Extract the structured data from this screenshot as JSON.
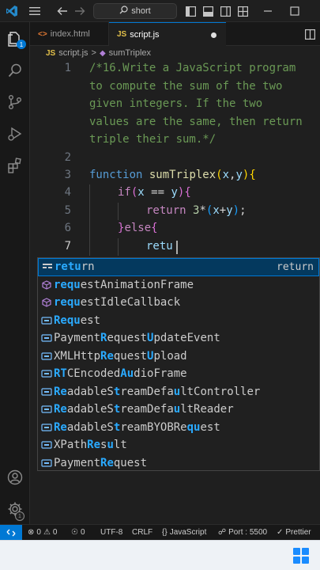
{
  "titlebar": {
    "search_text": "short",
    "icons": [
      "vscode-logo-icon",
      "menu-icon",
      "arrow-left-icon",
      "arrow-right-icon",
      "search-icon",
      "toggle-sidebar-icon",
      "toggle-panel-icon",
      "toggle-secondary-sidebar-icon",
      "customize-layout-icon",
      "minimize-icon",
      "maximize-icon"
    ]
  },
  "activity_bar": {
    "explorer_badge": "1",
    "items": [
      "explorer-icon",
      "search-icon",
      "source-control-icon",
      "run-debug-icon",
      "extensions-icon",
      "account-icon",
      "settings-gear-icon"
    ]
  },
  "tabs": [
    {
      "icon_text": "JS",
      "label": "index.html",
      "active": false
    },
    {
      "icon_text": "JS",
      "label": "script.js",
      "active": true,
      "modified": true
    }
  ],
  "breadcrumb": {
    "file": "script.js",
    "separator": ">",
    "symbol": "sumTriplex",
    "file_icon_text": "JS"
  },
  "editor": {
    "lines": [
      {
        "number": "1",
        "text": "/*16.Write a JavaScript program"
      },
      {
        "number": "",
        "text": "to compute the sum of the two"
      },
      {
        "number": "",
        "text": "given integers. If the two"
      },
      {
        "number": "",
        "text": "values are the same, then return"
      },
      {
        "number": "",
        "text": "triple their sum.*/"
      },
      {
        "number": "2",
        "text": ""
      },
      {
        "number": "3",
        "text": "function sumTriplex(x,y){"
      },
      {
        "number": "4",
        "text": "if(x == y){"
      },
      {
        "number": "5",
        "text": "return 3*(x+y);"
      },
      {
        "number": "6",
        "text": "}else{"
      },
      {
        "number": "7",
        "text": "retu"
      }
    ],
    "tokens": {
      "function_kw": "function",
      "function_name": "sumTriplex",
      "param_x": "x",
      "comma": ",",
      "param_y": "y",
      "if_kw": "if",
      "eq_op": " == ",
      "return_kw": "return",
      "num_3": "3",
      "mul": "*",
      "plus": "+",
      "semi": ";",
      "else_kw": "else",
      "open_paren": "(",
      "close_paren": ")",
      "open_brace": "{",
      "close_brace": "}",
      "typed": "retu"
    }
  },
  "suggestions": [
    {
      "pre": "",
      "match": "retu",
      "post": "rn",
      "icon": "keyword-icon",
      "detail": "return",
      "selected": true
    },
    {
      "parts": [
        [
          "b",
          "requ"
        ],
        [
          "t",
          "est"
        ],
        [
          "t",
          "Animation"
        ],
        [
          "t",
          "Frame"
        ]
      ],
      "icon": "method-icon"
    },
    {
      "parts": [
        [
          "b",
          "requ"
        ],
        [
          "t",
          "est"
        ],
        [
          "t",
          "IdleCallback"
        ]
      ],
      "icon": "method-icon"
    },
    {
      "parts": [
        [
          "b",
          "Requ"
        ],
        [
          "t",
          "est"
        ]
      ],
      "icon": "variable-icon"
    },
    {
      "parts": [
        [
          "t",
          "Payment"
        ],
        [
          "b",
          "R"
        ],
        [
          "t",
          "equest"
        ],
        [
          "b",
          "U"
        ],
        [
          "t",
          "pdateEvent"
        ]
      ],
      "icon": "variable-icon"
    },
    {
      "parts": [
        [
          "t",
          "XMLHttp"
        ],
        [
          "b",
          "Re"
        ],
        [
          "t",
          "quest"
        ],
        [
          "b",
          "U"
        ],
        [
          "t",
          "pload"
        ]
      ],
      "icon": "variable-icon"
    },
    {
      "parts": [
        [
          "b",
          "RT"
        ],
        [
          "t",
          "CEnc"
        ],
        [
          "t",
          "oded"
        ],
        [
          "b",
          "Au"
        ],
        [
          "t",
          "dioFrame"
        ]
      ],
      "icon": "variable-icon"
    },
    {
      "parts": [
        [
          "b",
          "Re"
        ],
        [
          "t",
          "adableS"
        ],
        [
          "b",
          "t"
        ],
        [
          "t",
          "reamDefa"
        ],
        [
          "b",
          "u"
        ],
        [
          "t",
          "ltController"
        ]
      ],
      "icon": "variable-icon"
    },
    {
      "parts": [
        [
          "b",
          "Re"
        ],
        [
          "t",
          "adableS"
        ],
        [
          "b",
          "t"
        ],
        [
          "t",
          "reamDefa"
        ],
        [
          "b",
          "u"
        ],
        [
          "t",
          "ltReader"
        ]
      ],
      "icon": "variable-icon"
    },
    {
      "parts": [
        [
          "b",
          "Re"
        ],
        [
          "t",
          "adableS"
        ],
        [
          "b",
          "t"
        ],
        [
          "t",
          "reamBYOBRe"
        ],
        [
          "b",
          "qu"
        ],
        [
          "t",
          "est"
        ]
      ],
      "icon": "variable-icon"
    },
    {
      "parts": [
        [
          "t",
          "XPath"
        ],
        [
          "b",
          "Re"
        ],
        [
          "t",
          "s"
        ],
        [
          "b",
          "u"
        ],
        [
          "t",
          "lt"
        ]
      ],
      "icon": "variable-icon"
    },
    {
      "parts": [
        [
          "t",
          "Payment"
        ],
        [
          "b",
          "Re"
        ],
        [
          "t",
          "quest"
        ]
      ],
      "icon": "variable-icon"
    }
  ],
  "statusbar": {
    "errors": "0",
    "warnings": "0",
    "ports": "0",
    "encoding": "UTF-8",
    "eol": "CRLF",
    "language": "JavaScript",
    "port": "Port : 5500",
    "prettier": "Prettier"
  },
  "colors": {
    "accent": "#0078d4",
    "editor_bg": "#1f1f1f",
    "match_highlight": "#2aaaff"
  }
}
